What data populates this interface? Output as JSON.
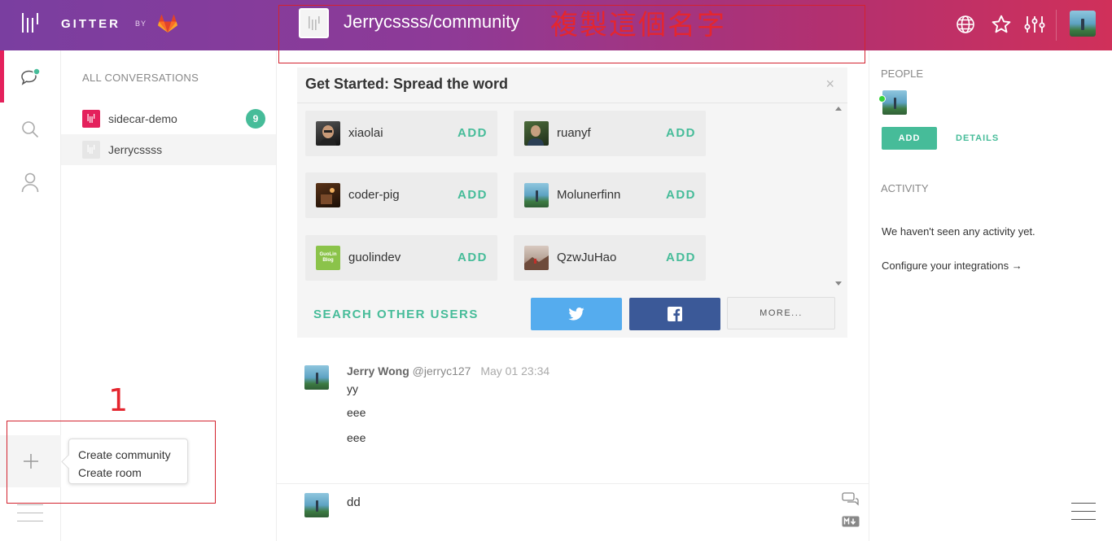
{
  "brand": {
    "name": "GITTER",
    "by": "BY"
  },
  "room": {
    "title": "Jerrycssss/community",
    "annotation": "複製這個名字"
  },
  "annotations": {
    "number": "1"
  },
  "conversations": {
    "heading": "ALL CONVERSATIONS",
    "items": [
      {
        "label": "sidecar-demo",
        "badge": "9",
        "icon_color": "#e4215c"
      },
      {
        "label": "Jerrycssss",
        "badge": "",
        "icon_color": "#e0e0e0"
      }
    ]
  },
  "create_menu": {
    "items": [
      "Create community",
      "Create room"
    ]
  },
  "spread_card": {
    "title": "Get Started: Spread the word",
    "close": "×",
    "add_label": "ADD",
    "users": [
      {
        "name": "xiaolai",
        "avatar": "person-dark"
      },
      {
        "name": "ruanyf",
        "avatar": "person-green"
      },
      {
        "name": "coder-pig",
        "avatar": "night-photo"
      },
      {
        "name": "Molunerfinn",
        "avatar": "sky-figure"
      },
      {
        "name": "guolindev",
        "avatar": "guolin-blog",
        "avatar_text": "GuoLin Blog"
      },
      {
        "name": "QzwJuHao",
        "avatar": "landscape-photo"
      }
    ],
    "search_label": "SEARCH OTHER USERS",
    "more_label": "MORE..."
  },
  "message": {
    "author": "Jerry Wong",
    "handle": "@jerryc127",
    "time": "May 01 23:34",
    "lines": [
      "yy",
      "eee",
      "eee"
    ]
  },
  "composer": {
    "value": "dd"
  },
  "right_panel": {
    "people_heading": "PEOPLE",
    "add_label": "ADD",
    "details_label": "DETAILS",
    "activity_heading": "ACTIVITY",
    "no_activity": "We haven't seen any activity yet.",
    "integrations": "Configure your integrations →"
  },
  "colors": {
    "accent": "#46bc99",
    "brand_start": "#7a3ea0",
    "brand_end": "#d0305a",
    "annotation": "#e4262f"
  }
}
